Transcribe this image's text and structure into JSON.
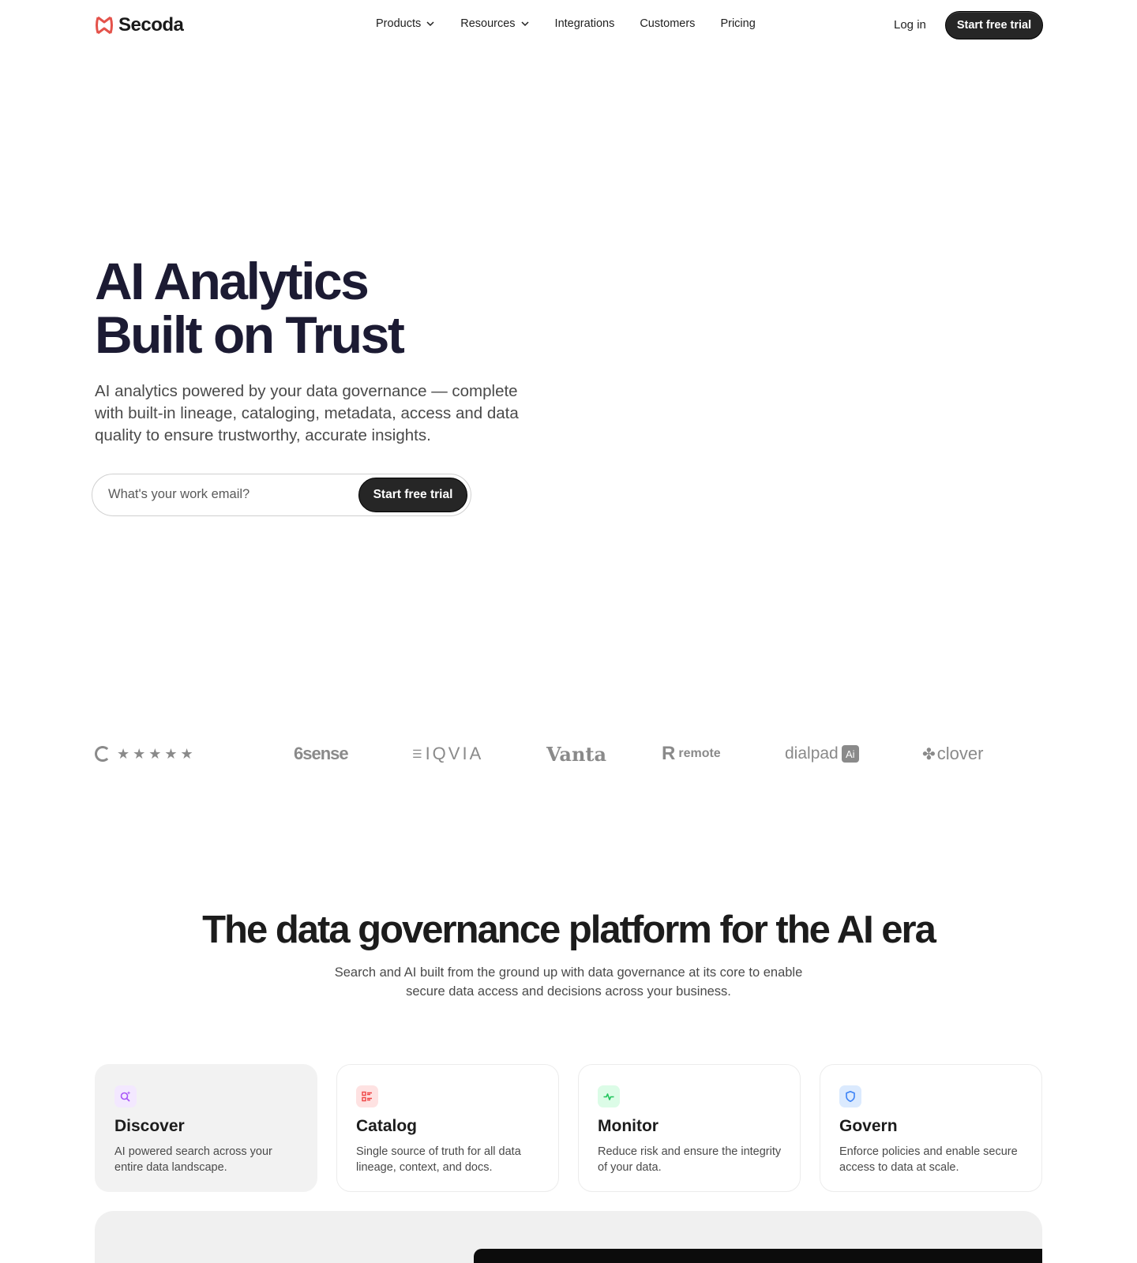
{
  "brand": {
    "name": "Secoda",
    "accent": "#e4524a"
  },
  "nav": {
    "links": [
      {
        "label": "Products",
        "dropdown": true
      },
      {
        "label": "Resources",
        "dropdown": true
      },
      {
        "label": "Integrations",
        "dropdown": false
      },
      {
        "label": "Customers",
        "dropdown": false
      },
      {
        "label": "Pricing",
        "dropdown": false
      }
    ],
    "login": "Log in",
    "cta": "Start free trial"
  },
  "hero": {
    "title_line1": "AI Analytics",
    "title_line2": "Built on Trust",
    "subtitle": "AI analytics powered by your data governance — complete with built-in lineage, cataloging, metadata, access and data quality to ensure trustworthy, accurate insights.",
    "email_placeholder": "What's your work email?",
    "cta": "Start free trial"
  },
  "logos": {
    "g2_stars": "★★★★★",
    "items": [
      "6sense",
      "IQVIA",
      "Vanta",
      "remote",
      "dialpad",
      "clover"
    ]
  },
  "section": {
    "title": "The data governance platform for the AI era",
    "subtitle": "Search and AI built from the ground up with data governance at its core to enable secure data access and decisions across your business."
  },
  "cards": [
    {
      "title": "Discover",
      "desc": "AI powered search across your entire data landscape.",
      "icon": "search-sparkle-icon",
      "color": "#a855f7",
      "bg": "#f3e8ff"
    },
    {
      "title": "Catalog",
      "desc": "Single source of truth for all data lineage, context, and docs.",
      "icon": "catalog-list-icon",
      "color": "#ef4444",
      "bg": "#fee2e2"
    },
    {
      "title": "Monitor",
      "desc": "Reduce risk and ensure the integrity of your data.",
      "icon": "pulse-icon",
      "color": "#22c55e",
      "bg": "#dcfce7"
    },
    {
      "title": "Govern",
      "desc": "Enforce policies and enable secure access to data at scale.",
      "icon": "shield-icon",
      "color": "#3b82f6",
      "bg": "#dbeafe"
    }
  ]
}
